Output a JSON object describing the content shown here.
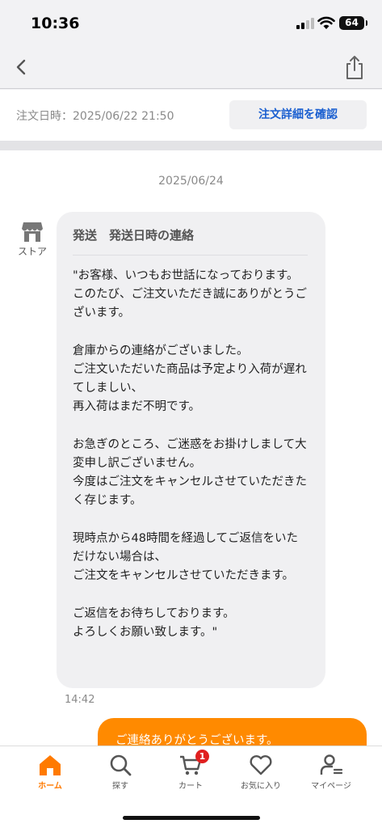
{
  "status_bar": {
    "time": "10:36",
    "battery": "64"
  },
  "order": {
    "date_text": "注文日時：2025/06/22 21:50",
    "detail_button": "注文詳細を確認"
  },
  "chat": {
    "date_separator": "2025/06/24",
    "store_label": "ストア",
    "message": {
      "subject": "発送　発送日時の連絡",
      "body": "\"お客様、いつもお世話になっております。\nこのたび、ご注文いただき誠にありがとうございます。\n\n倉庫からの連絡がございました。\nご注文いただいた商品は予定より入荷が遅れてしましい、\n再入荷はまだ不明です。\n\nお急ぎのところ、ご迷惑をお掛けしまして大変申し訳ございません。\n今度はご注文をキャンセルさせていただきたく存じます。\n\n現時点から48時間を経過してご返信をいただけない場合は、\nご注文をキャンセルさせていただきます。\n\nご返信をお待ちしております。\nよろしくお願い致します。\"",
      "time": "14:42"
    },
    "reply": {
      "text": "ご連絡ありがとうございます。"
    }
  },
  "tabs": [
    {
      "label": "ホーム",
      "icon": "home-icon",
      "active": true
    },
    {
      "label": "探す",
      "icon": "search-icon"
    },
    {
      "label": "カート",
      "icon": "cart-icon",
      "badge": "1"
    },
    {
      "label": "お気に入り",
      "icon": "heart-icon"
    },
    {
      "label": "マイページ",
      "icon": "user-icon"
    }
  ],
  "colors": {
    "accent": "#ff8a00",
    "link": "#1a5fd0",
    "badge": "#e02020"
  }
}
